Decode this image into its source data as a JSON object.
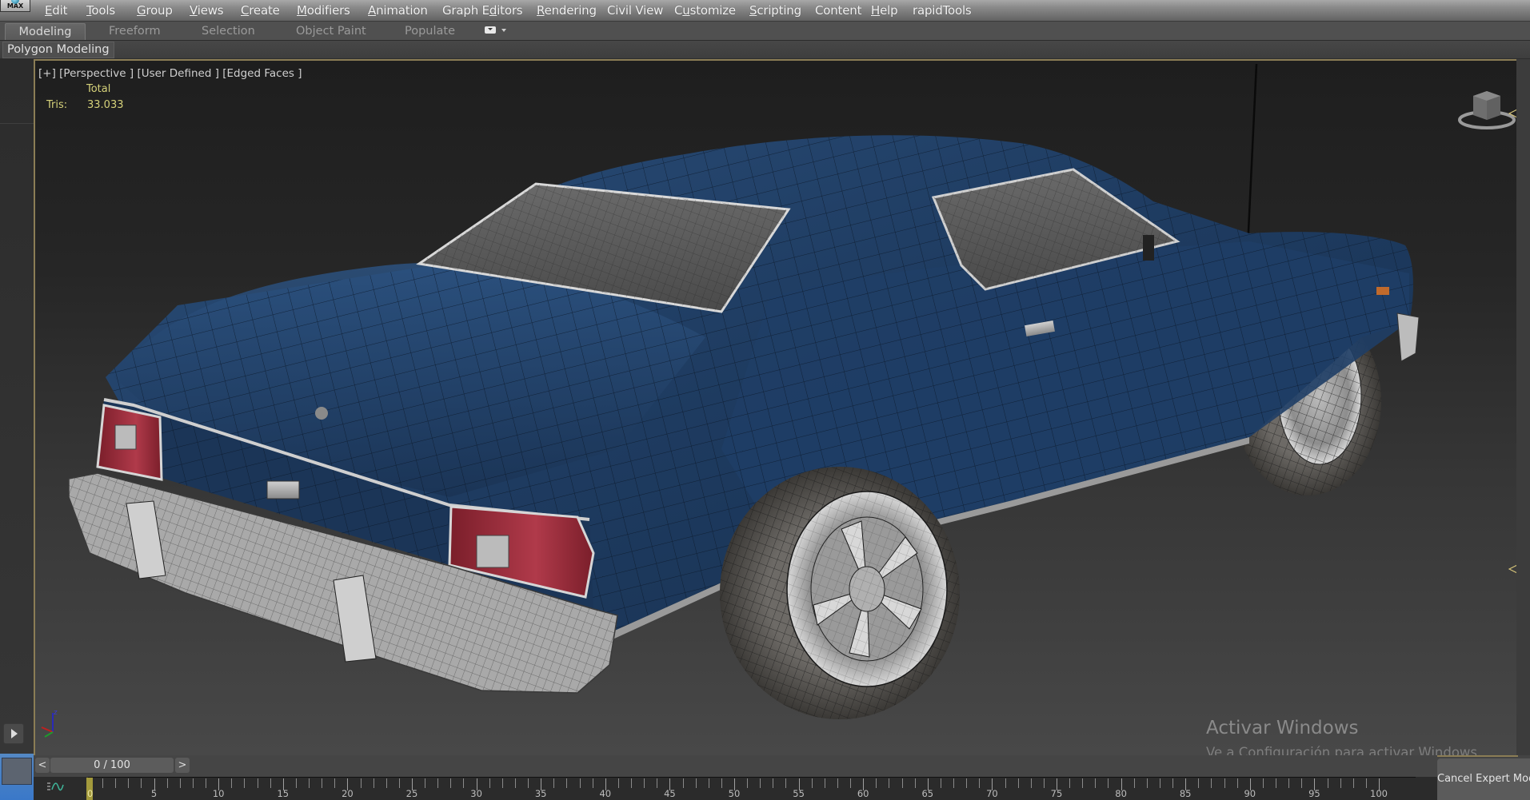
{
  "app": {
    "logo_label": "MAX",
    "menu": [
      {
        "label": "Edit",
        "mnemonic": "E"
      },
      {
        "label": "Tools",
        "mnemonic": "T"
      },
      {
        "label": "Group",
        "mnemonic": "G"
      },
      {
        "label": "Views",
        "mnemonic": "V"
      },
      {
        "label": "Create",
        "mnemonic": "C"
      },
      {
        "label": "Modifiers",
        "mnemonic": "M"
      },
      {
        "label": "Animation",
        "mnemonic": "A"
      },
      {
        "label": "Graph Editors",
        "mnemonic": "d"
      },
      {
        "label": "Rendering",
        "mnemonic": "R"
      },
      {
        "label": "Civil View",
        "mnemonic": ""
      },
      {
        "label": "Customize",
        "mnemonic": "u"
      },
      {
        "label": "Scripting",
        "mnemonic": "S"
      },
      {
        "label": "Content",
        "mnemonic": ""
      },
      {
        "label": "Help",
        "mnemonic": "H"
      },
      {
        "label": "rapidTools",
        "mnemonic": ""
      }
    ]
  },
  "ribbon": {
    "tabs": [
      {
        "label": "Modeling",
        "active": true
      },
      {
        "label": "Freeform",
        "active": false
      },
      {
        "label": "Selection",
        "active": false
      },
      {
        "label": "Object Paint",
        "active": false
      },
      {
        "label": "Populate",
        "active": false
      }
    ],
    "toggle_icon": "ribbon-toggle-icon",
    "panel_label": "Polygon Modeling"
  },
  "viewport": {
    "label": "[+] [Perspective ] [User Defined ] [Edged Faces ]",
    "stats": {
      "header": "Total",
      "tris_label": "Tris:",
      "tris_value": "33.033"
    },
    "viewcube_icon": "viewcube-icon",
    "axis_labels": {
      "z": "z",
      "x": "x",
      "y": "y"
    },
    "colors": {
      "border": "#8b7d55",
      "stats_text": "#d6d27a",
      "car_paint": "#1f3d63",
      "taillight": "#9e2a38"
    }
  },
  "watermark": {
    "title": "Activar Windows",
    "subtitle": "Ve a Configuración para activar Windows."
  },
  "timeslider": {
    "prev_label": "<",
    "next_label": ">",
    "current_frame": 0,
    "total_frames": 100,
    "display": "0 / 100"
  },
  "trackbar": {
    "start": 0,
    "end": 100,
    "major_step": 5,
    "labels": [
      "0",
      "5",
      "10",
      "15",
      "20",
      "25",
      "30",
      "35",
      "40",
      "45",
      "50",
      "55",
      "60",
      "65",
      "70",
      "75",
      "80",
      "85",
      "90",
      "95",
      "100"
    ],
    "playhead_frame": 0
  },
  "expert_mode": {
    "cancel_label": "Cancel Expert Mode"
  }
}
